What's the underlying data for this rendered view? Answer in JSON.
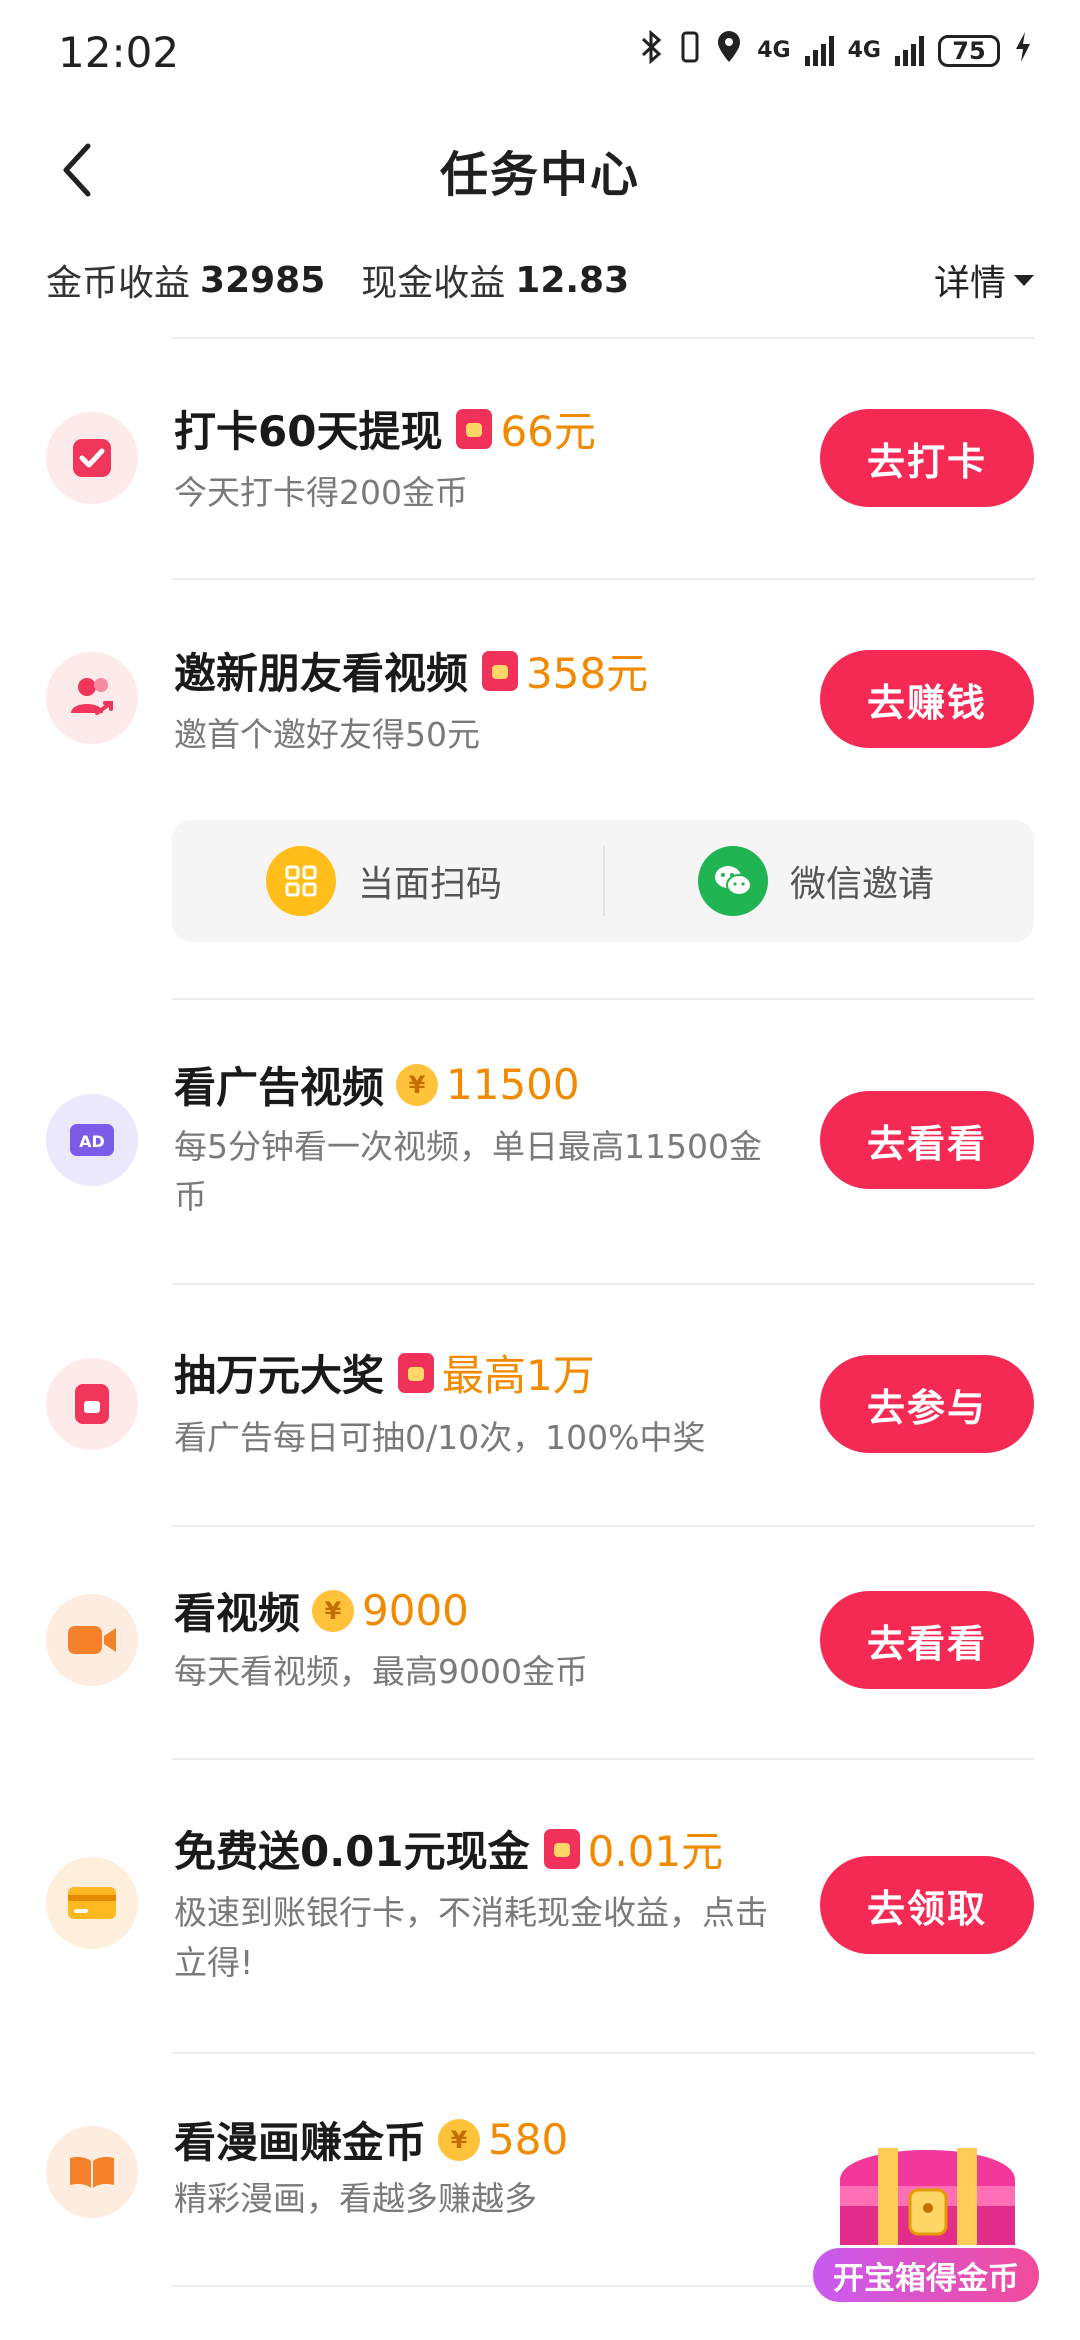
{
  "status_bar": {
    "time": "12:02",
    "network_1": "4G",
    "network_2": "4G",
    "battery": "75"
  },
  "header": {
    "title": "任务中心"
  },
  "earnings": {
    "coin_label": "金币收益",
    "coin_value": "32985",
    "cash_label": "现金收益",
    "cash_value": "12.83",
    "details_label": "详情"
  },
  "tasks": [
    {
      "title": "打卡60天提现",
      "reward_icon": "red-envelope-icon",
      "reward": "66元",
      "desc": "今天打卡得200金币",
      "button": "去打卡",
      "icon": "checkin-icon"
    },
    {
      "title": "邀新朋友看视频",
      "reward_icon": "red-envelope-icon",
      "reward": "358元",
      "desc": "邀首个邀好友得50元",
      "button": "去赚钱",
      "icon": "invite-friends-icon"
    },
    {
      "title": "看广告视频",
      "reward_icon": "coin-icon",
      "reward": "11500",
      "desc": "每5分钟看一次视频，单日最高11500金币",
      "button": "去看看",
      "icon": "ad-icon"
    },
    {
      "title": "抽万元大奖",
      "reward_icon": "red-envelope-icon",
      "reward": "最高1万",
      "desc": "看广告每日可抽0/10次，100%中奖",
      "button": "去参与",
      "icon": "lottery-icon"
    },
    {
      "title": "看视频",
      "reward_icon": "coin-icon",
      "reward": "9000",
      "desc": "每天看视频，最高9000金币",
      "button": "去看看",
      "icon": "video-camera-icon"
    },
    {
      "title": "免费送0.01元现金",
      "reward_icon": "red-envelope-icon",
      "reward": "0.01元",
      "desc": "极速到账银行卡，不消耗现金收益，点击立得!",
      "button": "去领取",
      "icon": "bank-card-icon"
    },
    {
      "title": "看漫画赚金币",
      "reward_icon": "coin-icon",
      "reward": "580",
      "desc": "精彩漫画，看越多赚越多",
      "icon": "comic-book-icon"
    }
  ],
  "invite_options": {
    "scan_label": "当面扫码",
    "wechat_label": "微信邀请"
  },
  "treasure_chest": {
    "label": "开宝箱得金币"
  },
  "colors": {
    "accent": "#f52a54",
    "reward": "#f28a00"
  }
}
